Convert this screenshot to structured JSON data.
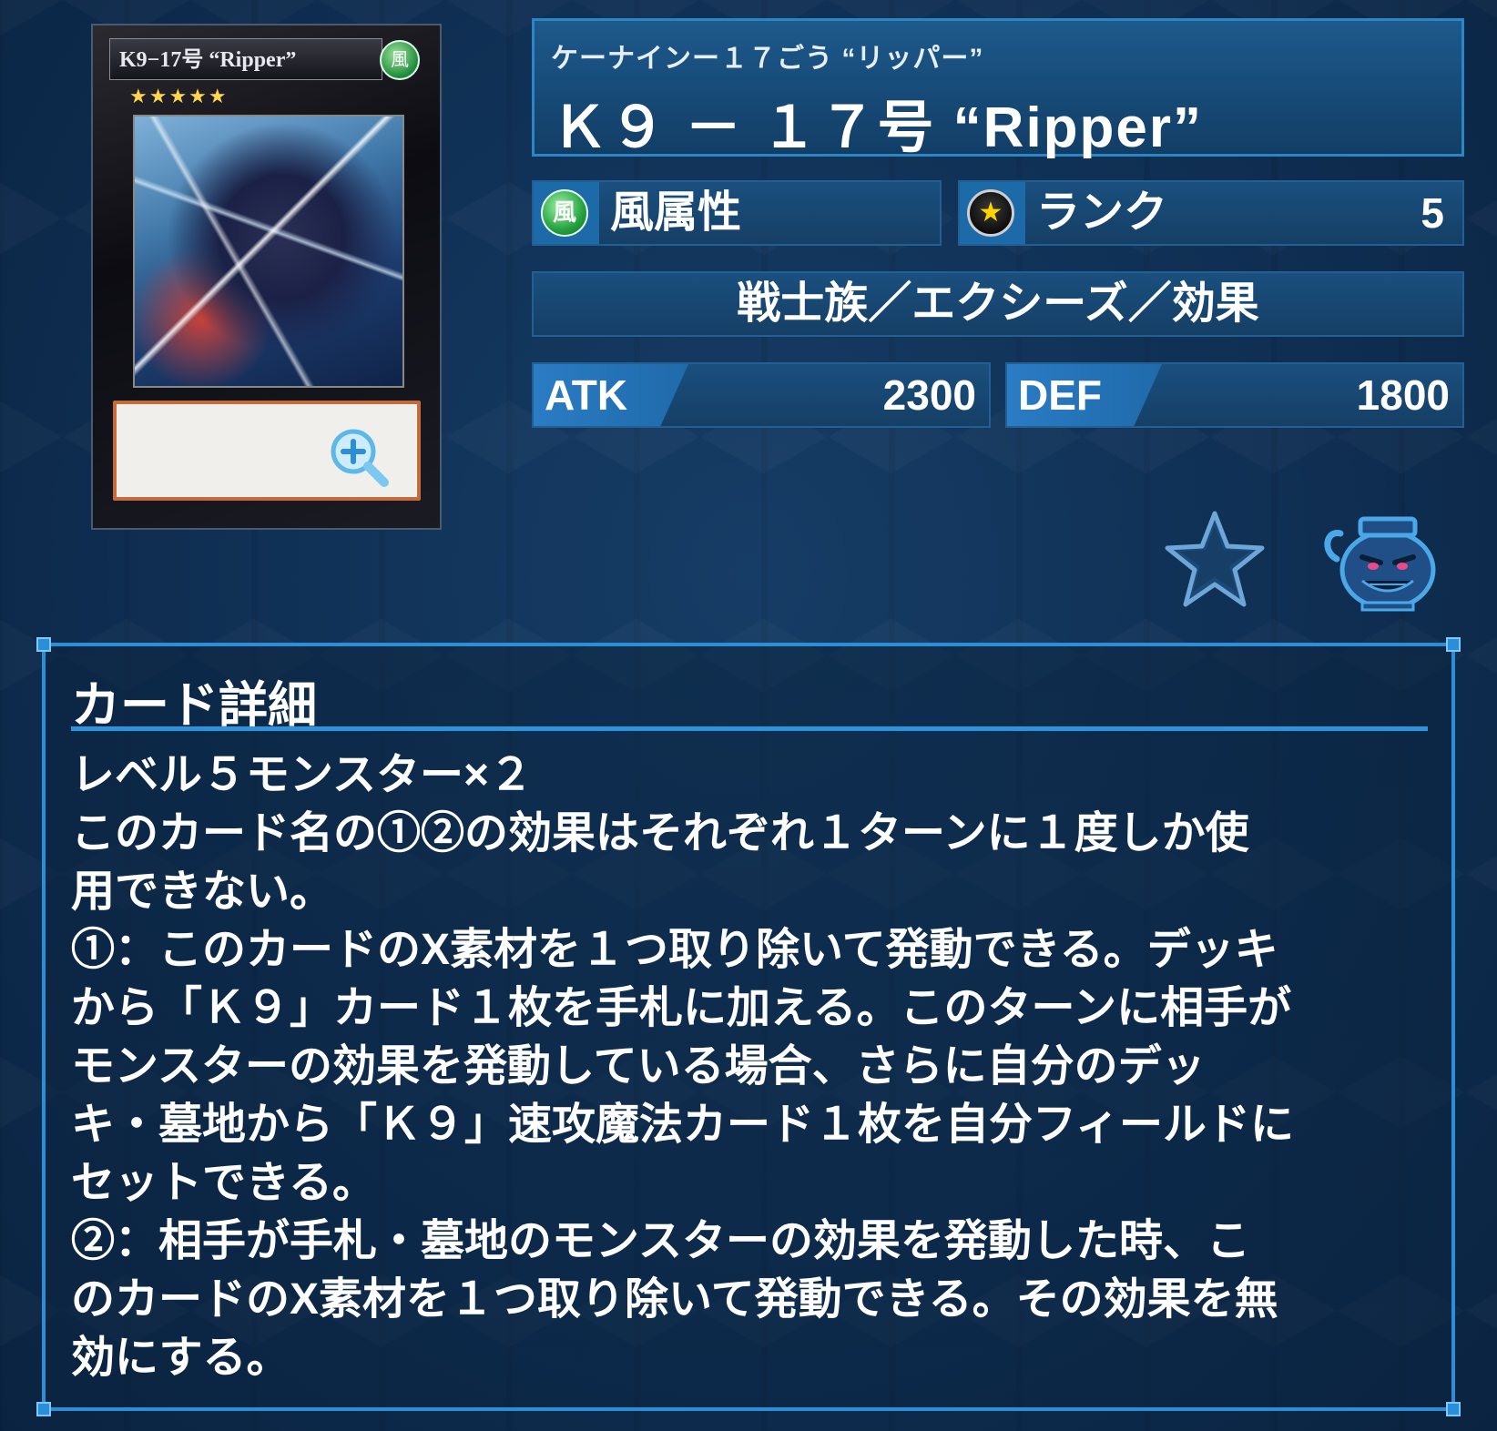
{
  "card_image": {
    "name_text": "K9−17号 “Ripper”",
    "attribute_glyph": "風",
    "stars": "★★★★★"
  },
  "card": {
    "ruby": "ケーナインー１７ごう “リッパー”",
    "name": "Ｋ９ － １７号 “Ripper”",
    "attribute": "風属性",
    "attribute_icon_glyph": "風",
    "rank_label": "ランク",
    "rank_icon_glyph": "★",
    "rank_value": "5",
    "type_line": "戦士族／エクシーズ／効果",
    "atk_label": "ATK",
    "atk_value": "2300",
    "def_label": "DEF",
    "def_value": "1800"
  },
  "detail": {
    "title": "カード詳細",
    "lines": [
      "レベル５モンスター×２",
      "このカード名の①②の効果はそれぞれ１ターンに１度しか使",
      "用できない。",
      "①：このカードのX素材を１つ取り除いて発動できる。デッキ",
      "から「Ｋ９」カード１枚を手札に加える。このターンに相手が",
      "モンスターの効果を発動している場合、さらに自分のデッ",
      "キ・墓地から「Ｋ９」速攻魔法カード１枚を自分フィールドに",
      "セットできる。",
      "②：相手が手札・墓地のモンスターの効果を発動した時、こ",
      "のカードのX素材を１つ取り除いて発動できる。その効果を無",
      "効にする。"
    ]
  },
  "icons": {
    "zoom": "zoom-in-icon",
    "favorite": "star-icon",
    "pot": "pot-of-greed-icon"
  },
  "colors": {
    "accent": "#2a8fd6",
    "panel": "#174a77",
    "attribute_wind": "#24a23f",
    "rank_star": "#ffd400",
    "card_text_border": "#c56a3b"
  }
}
